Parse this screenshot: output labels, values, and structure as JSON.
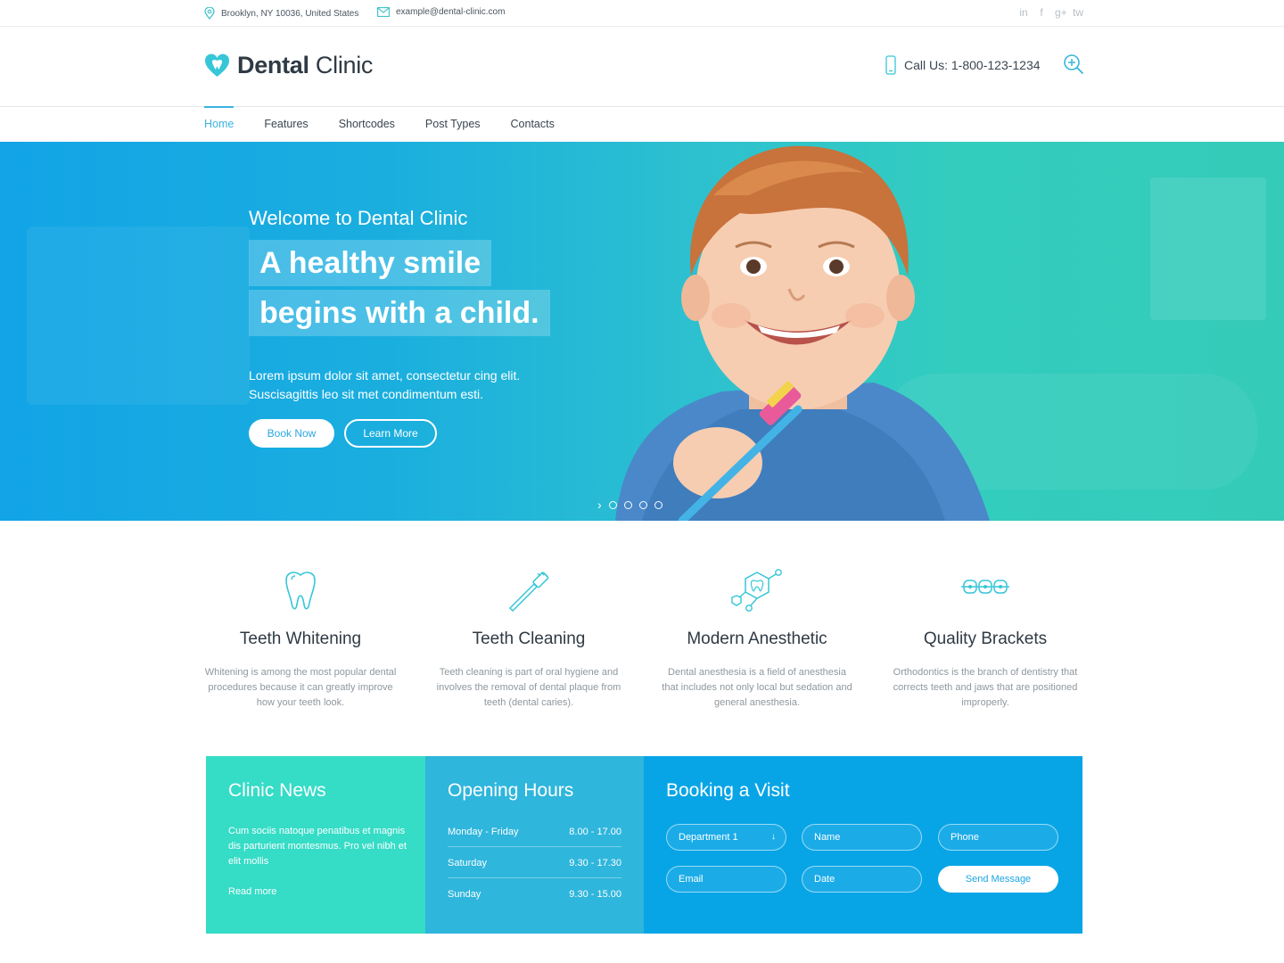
{
  "topbar": {
    "address": "Brooklyn, NY 10036, United States",
    "email": "example@dental-clinic.com",
    "social": [
      "in",
      "f",
      "g+",
      "tw"
    ]
  },
  "header": {
    "brand_bold": "Dental",
    "brand_light": " Clinic",
    "call": "Call Us: 1-800-123-1234"
  },
  "nav": {
    "items": [
      "Home",
      "Features",
      "Shortcodes",
      "Post Types",
      "Contacts"
    ],
    "active": "Home"
  },
  "hero": {
    "welcome": "Welcome to Dental Clinic",
    "headline1": "A healthy smile",
    "headline2": "begins with a child.",
    "description": "Lorem ipsum dolor sit amet, consectetur cing elit. Suscisagittis leo sit met condimentum esti.",
    "book_label": "Book Now",
    "learn_label": "Learn More",
    "slider_arrow": "›"
  },
  "services": [
    {
      "title": "Teeth Whitening",
      "text": "Whitening is among the most popular dental procedures because it can greatly improve how your teeth look.",
      "icon": "tooth-icon"
    },
    {
      "title": "Teeth Cleaning",
      "text": "Teeth cleaning is part of oral hygiene and involves the removal of dental plaque from teeth (dental caries).",
      "icon": "toothbrush-icon"
    },
    {
      "title": "Modern Anesthetic",
      "text": "Dental anesthesia is a field of anesthesia that includes not only local but sedation and general anesthesia.",
      "icon": "molecule-tooth-icon"
    },
    {
      "title": "Quality Brackets",
      "text": "Orthodontics is the branch of dentistry that corrects teeth and jaws that are positioned improperly.",
      "icon": "braces-icon"
    }
  ],
  "news": {
    "title": "Clinic News",
    "text": "Cum sociis natoque penatibus et magnis dis parturient montesmus. Pro vel nibh et elit mollis",
    "read_more": "Read more"
  },
  "hours": {
    "title": "Opening Hours",
    "rows": [
      {
        "day": "Monday - Friday",
        "time": "8.00 - 17.00"
      },
      {
        "day": "Saturday",
        "time": "9.30 - 17.30"
      },
      {
        "day": "Sunday",
        "time": "9.30 - 15.00"
      }
    ]
  },
  "booking": {
    "title": "Booking a Visit",
    "department": "Department 1",
    "department_caret": "↓",
    "name_placeholder": "Name",
    "phone_placeholder": "Phone",
    "email_placeholder": "Email",
    "date_placeholder": "Date",
    "send_label": "Send Message"
  },
  "colors": {
    "accent": "#3ab2e3",
    "news_bg": "#35dcc6",
    "hours_bg": "#2fb6dc",
    "booking_bg": "#08a5e6"
  }
}
